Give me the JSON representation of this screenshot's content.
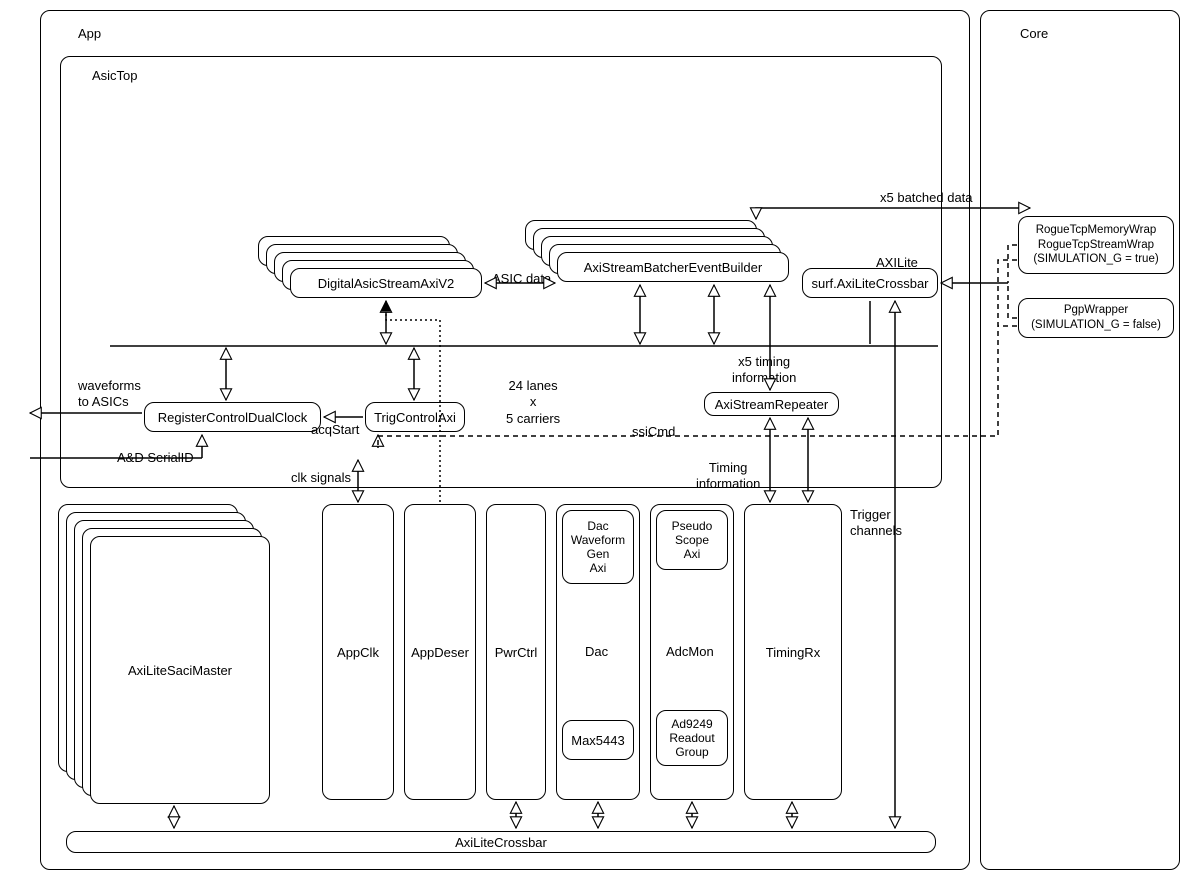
{
  "containers": {
    "app": "App",
    "core": "Core",
    "asicTop": "AsicTop"
  },
  "blocks": {
    "digitalAsicStreamAxiV2": "DigitalAsicStreamAxiV2",
    "axiStreamBatcherEventBuilder": "AxiStreamBatcherEventBuilder",
    "surfAxiLiteCrossbar": "surf.AxiLiteCrossbar",
    "registerControlDualClock": "RegisterControlDualClock",
    "trigControlAxi": "TrigControlAxi",
    "axiStreamRepeater": "AxiStreamRepeater",
    "axiLiteSaciMaster": "AxiLiteSaciMaster",
    "appClk": "AppClk",
    "appDeser": "AppDeser",
    "pwrCtrl": "PwrCtrl",
    "dac": "Dac",
    "dacWaveformGenAxi": "Dac\nWaveform\nGen\nAxi",
    "max5443": "Max5443",
    "adcMon": "AdcMon",
    "pseudoScopeAxi": "Pseudo\nScope\nAxi",
    "ad9249ReadoutGroup": "Ad9249\nReadout\nGroup",
    "timingRx": "TimingRx",
    "axiLiteCrossbar": "AxiLiteCrossbar",
    "rogue": "RogueTcpMemoryWrap\nRogueTcpStreamWrap\n(SIMULATION_G = true)",
    "pgpWrapper": "PgpWrapper\n(SIMULATION_G = false)"
  },
  "labels": {
    "asicData": "ASIC data",
    "x5Batched": "x5 batched data",
    "axiLite": "AXILite",
    "x5Timing": "x5 timing\ninformation",
    "waveforms": "waveforms\nto ASICs",
    "adSerialID": "A&D SerialID",
    "acqStart": "acqStart",
    "ssiCmd": "ssiCmd",
    "lanes": "24 lanes\nx\n5 carriers",
    "clkSignals": "clk signals",
    "timingInfo": "Timing\ninformation",
    "triggerChannels": "Trigger\nchannels"
  }
}
